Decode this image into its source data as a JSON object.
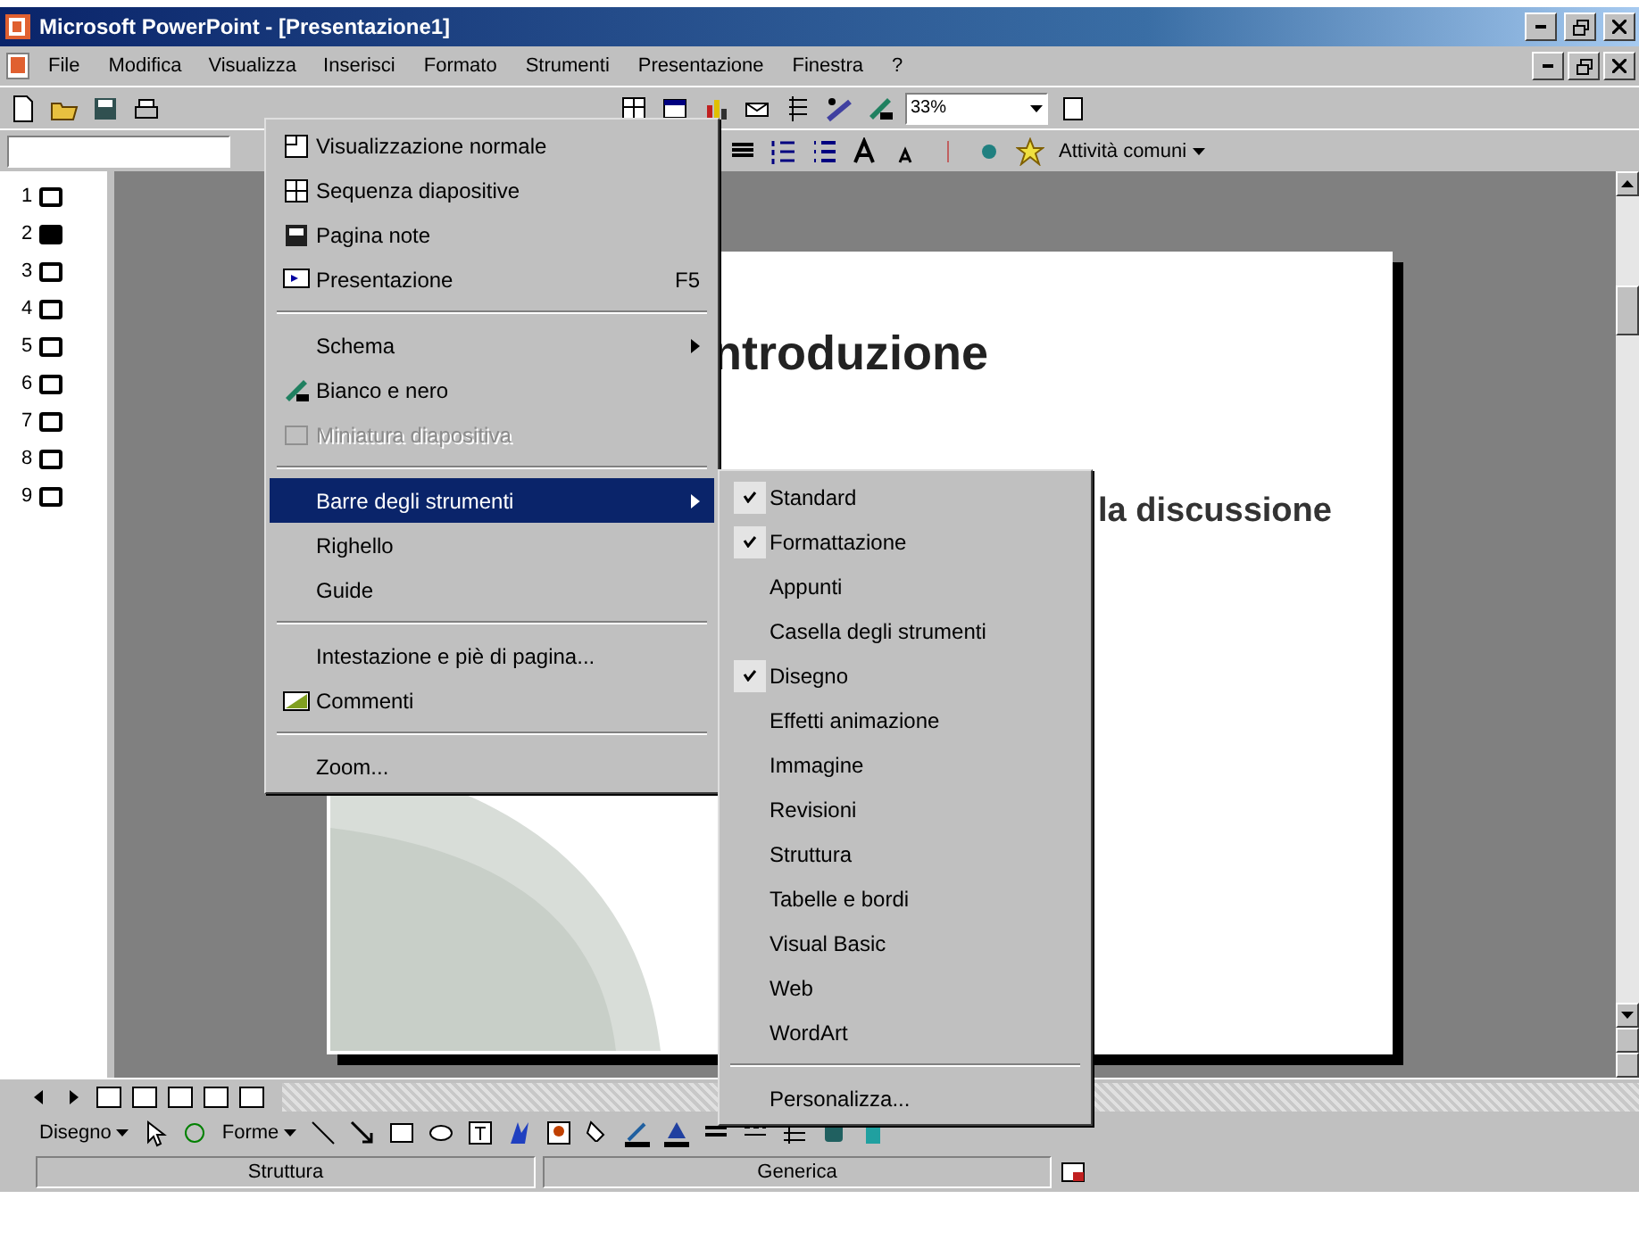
{
  "window": {
    "title": "Microsoft PowerPoint - [Presentazione1]"
  },
  "menu_bar": [
    {
      "label": "File",
      "selected": false
    },
    {
      "label": "Modifica",
      "selected": false
    },
    {
      "label": "Visualizza",
      "selected": true
    },
    {
      "label": "Inserisci",
      "selected": false
    },
    {
      "label": "Formato",
      "selected": false
    },
    {
      "label": "Strumenti",
      "selected": false
    },
    {
      "label": "Presentazione",
      "selected": false
    },
    {
      "label": "Finestra",
      "selected": false
    },
    {
      "label": "?",
      "selected": false
    }
  ],
  "standard_toolbar": {
    "zoom": "33%"
  },
  "formatting_toolbar": {
    "common_tasks": "Attività comuni"
  },
  "outline": {
    "slides": [
      {
        "number": "1",
        "selected": false
      },
      {
        "number": "2",
        "selected": true
      },
      {
        "number": "3",
        "selected": false
      },
      {
        "number": "4",
        "selected": false
      },
      {
        "number": "5",
        "selected": false
      },
      {
        "number": "6",
        "selected": false
      },
      {
        "number": "7",
        "selected": false
      },
      {
        "number": "8",
        "selected": false
      },
      {
        "number": "9",
        "selected": false
      }
    ]
  },
  "slide": {
    "title": "ntroduzione",
    "bullet": "la discussione"
  },
  "view_menu": {
    "items": [
      {
        "kind": "item",
        "label": "Visualizzazione normale",
        "has_icon": true,
        "selected": false,
        "disabled": false
      },
      {
        "kind": "item",
        "label": "Sequenza diapositive",
        "has_icon": true,
        "selected": false,
        "disabled": false
      },
      {
        "kind": "item",
        "label": "Pagina note",
        "has_icon": true,
        "selected": false,
        "disabled": false
      },
      {
        "kind": "item",
        "label": "Presentazione",
        "shortcut": "F5",
        "has_icon": true,
        "selected": false,
        "disabled": false
      },
      {
        "kind": "separator"
      },
      {
        "kind": "submenu",
        "label": "Schema",
        "has_icon": false,
        "selected": false,
        "disabled": false
      },
      {
        "kind": "item",
        "label": "Bianco e nero",
        "has_icon": true,
        "selected": false,
        "disabled": false
      },
      {
        "kind": "item",
        "label": "Miniatura diapositiva",
        "has_icon": true,
        "selected": false,
        "disabled": true
      },
      {
        "kind": "separator"
      },
      {
        "kind": "submenu",
        "label": "Barre degli strumenti",
        "has_icon": false,
        "selected": true,
        "disabled": false
      },
      {
        "kind": "item",
        "label": "Righello",
        "has_icon": false,
        "selected": false,
        "disabled": false
      },
      {
        "kind": "item",
        "label": "Guide",
        "has_icon": false,
        "selected": false,
        "disabled": false
      },
      {
        "kind": "separator"
      },
      {
        "kind": "item",
        "label": "Intestazione e piè di pagina...",
        "has_icon": false,
        "selected": false,
        "disabled": false
      },
      {
        "kind": "item",
        "label": "Commenti",
        "has_icon": true,
        "selected": false,
        "disabled": false
      },
      {
        "kind": "separator"
      },
      {
        "kind": "item",
        "label": "Zoom...",
        "has_icon": false,
        "selected": false,
        "disabled": false
      }
    ]
  },
  "toolbars_submenu": {
    "items": [
      {
        "label": "Standard",
        "checked": true
      },
      {
        "label": "Formattazione",
        "checked": true
      },
      {
        "label": "Appunti",
        "checked": false
      },
      {
        "label": "Casella degli strumenti",
        "checked": false
      },
      {
        "label": "Disegno",
        "checked": true
      },
      {
        "label": "Effetti animazione",
        "checked": false
      },
      {
        "label": "Immagine",
        "checked": false
      },
      {
        "label": "Revisioni",
        "checked": false
      },
      {
        "label": "Struttura",
        "checked": false
      },
      {
        "label": "Tabelle e bordi",
        "checked": false
      },
      {
        "label": "Visual Basic",
        "checked": false
      },
      {
        "label": "Web",
        "checked": false
      },
      {
        "label": "WordArt",
        "checked": false
      }
    ],
    "customize": "Personalizza..."
  },
  "drawing_toolbar": {
    "draw": "Disegno",
    "shapes": "Forme"
  },
  "status_bar": [
    {
      "text": "Struttura"
    },
    {
      "text": "Generica"
    }
  ]
}
